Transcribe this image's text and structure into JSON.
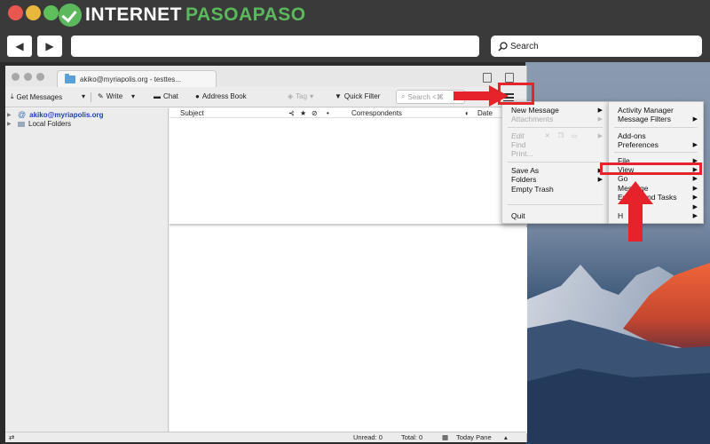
{
  "site": {
    "logo_a": "INTERNET",
    "logo_b": "PASOAPASO"
  },
  "browser": {
    "search_placeholder": "Search"
  },
  "app": {
    "tab_title": "akiko@myriapolis.org - testtes...",
    "toolbar": {
      "get_messages": "Get Messages",
      "write": "Write",
      "chat": "Chat",
      "address_book": "Address Book",
      "tag": "Tag",
      "quick_filter": "Quick Filter",
      "search_placeholder": "Search <⌘"
    },
    "folders": [
      "akiko@myriapolis.org",
      "Local Folders"
    ],
    "columns": {
      "subject": "Subject",
      "correspondents": "Correspondents",
      "date": "Date"
    },
    "status": {
      "unread": "Unread: 0",
      "total": "Total: 0",
      "today_pane": "Today Pane"
    }
  },
  "menu_main": {
    "new_message": "New Message",
    "attachments": "Attachments",
    "edit": "Edit",
    "find": "Find",
    "print": "Print...",
    "save_as": "Save As",
    "folders": "Folders",
    "empty_trash": "Empty Trash",
    "quit": "Quit"
  },
  "menu_sub": {
    "activity_manager": "Activity Manager",
    "message_filters": "Message Filters",
    "add_ons": "Add-ons",
    "preferences": "Preferences",
    "file": "File",
    "view": "View",
    "go": "Go",
    "message": "Message",
    "events_tasks": "Events and Tasks",
    "tools": "",
    "help": "H"
  },
  "colors": {
    "annotation": "#e6232b",
    "brand_green": "#5cb85c",
    "link_blue": "#1f3fb8"
  }
}
